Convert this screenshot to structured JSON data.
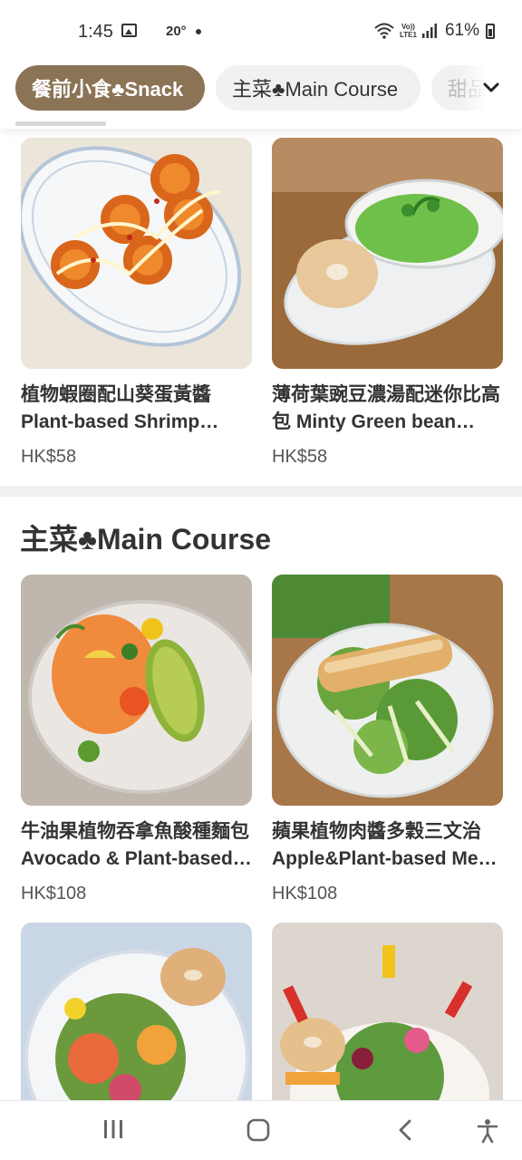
{
  "status": {
    "time": "1:45",
    "temp": "20°",
    "battery": "61%",
    "lte_top": "Vo))",
    "lte_bottom": "LTE1"
  },
  "tabs": [
    {
      "label": "餐前小食♣Snack",
      "active": true
    },
    {
      "label": "主菜♣Main Course",
      "active": false
    },
    {
      "label": "甜品",
      "active": false
    }
  ],
  "snack_items": [
    {
      "name": "植物蝦圈配山葵蛋黃醬 Plant-based Shrimp Rings with Wasabi Mayo",
      "price": "HK$58"
    },
    {
      "name": "薄荷葉豌豆濃湯配迷你比高包 Minty Green bean Soup with Mini Bagel",
      "price": "HK$58"
    }
  ],
  "main_section": {
    "title": "主菜♣Main Course"
  },
  "main_items": [
    {
      "name": "牛油果植物吞拿魚酸種麵包 Avocado & Plant-based Tuna Sourdough",
      "price": "HK$108"
    },
    {
      "name": "蘋果植物肉醬多穀三文治 Apple&Plant-based Meat Multigrain Sandwich",
      "price": "HK$108"
    },
    {
      "name": "",
      "price": ""
    },
    {
      "name": "",
      "price": ""
    }
  ],
  "colors": {
    "accent": "#8b7356",
    "tab_inactive_bg": "#f1f1f1",
    "divider": "#f0f0f0"
  }
}
